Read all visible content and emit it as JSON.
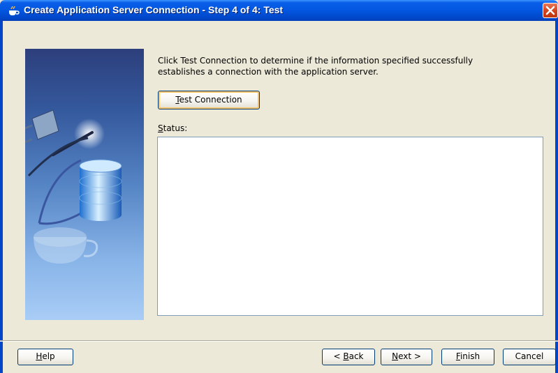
{
  "window": {
    "title": "Create Application Server Connection - Step 4 of 4: Test"
  },
  "icons": {
    "title_icon": "coffee-cup-icon",
    "close": "close-icon",
    "wizard_illustration": "database-plug-illustration"
  },
  "content": {
    "instructions": "Click Test Connection to determine if the information specified successfully establishes a connection with the application server.",
    "test_button": {
      "mnemonic": "T",
      "rest": "est Connection"
    },
    "status_label": {
      "mnemonic": "S",
      "rest": "tatus:"
    },
    "status_text": ""
  },
  "footer": {
    "help": {
      "mnemonic": "H",
      "rest": "elp"
    },
    "back": {
      "prefix": "< ",
      "mnemonic": "B",
      "rest": "ack"
    },
    "next": {
      "mnemonic": "N",
      "rest": "ext >"
    },
    "finish": {
      "mnemonic": "F",
      "rest": "inish"
    },
    "cancel": "Cancel"
  },
  "colors": {
    "title_bar": "#0256e0",
    "dialog_background": "#ece9d8",
    "button_border": "#003c74",
    "focus_highlight": "#f7c46b"
  }
}
